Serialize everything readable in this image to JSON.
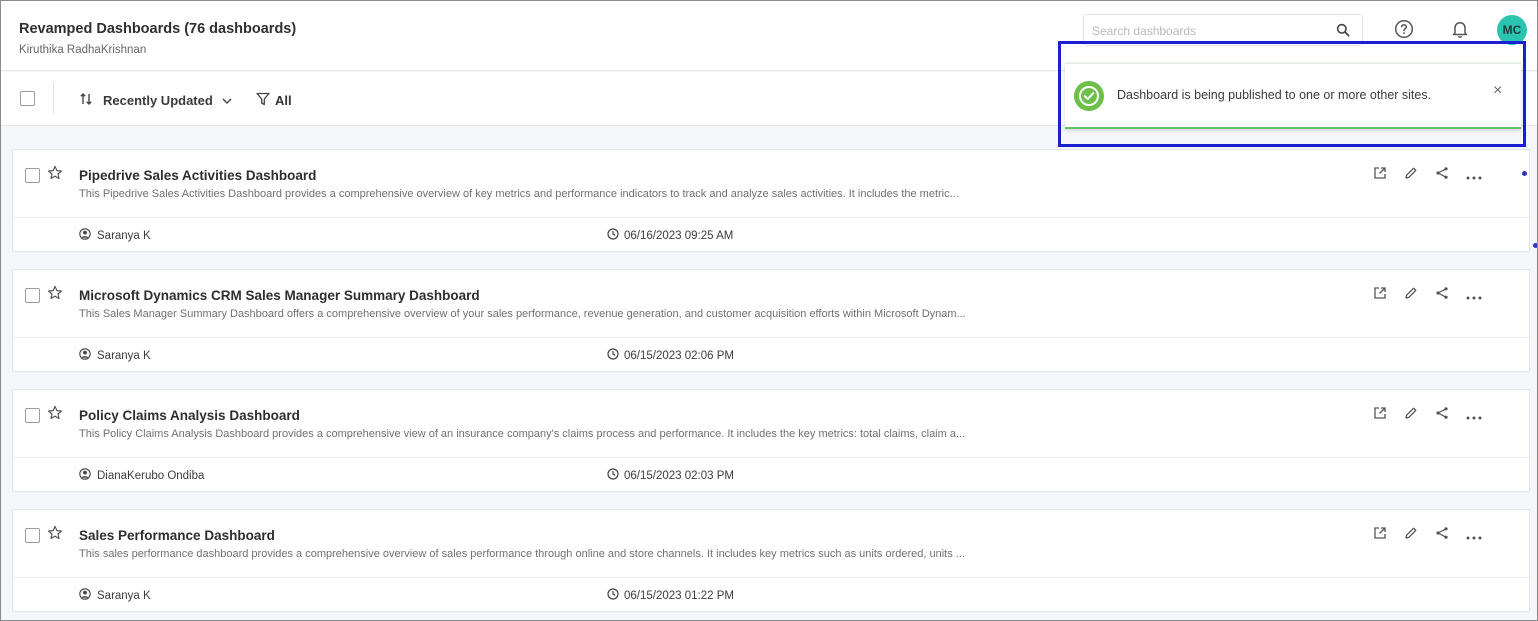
{
  "header": {
    "title": "Revamped Dashboards (76 dashboards)",
    "subtitle": "Kiruthika RadhaKrishnan",
    "search_placeholder": "Search dashboards",
    "avatar_initials": "MC",
    "avatar_color": "#2bc4b1"
  },
  "toolbar": {
    "sort_label": "Recently Updated",
    "filter_label": "All"
  },
  "toast": {
    "message": "Dashboard is being published to one or more other sites.",
    "close_glyph": "×",
    "status_color": "#6cc04a",
    "highlight_color": "#1a1fd1"
  },
  "dashboards": [
    {
      "name": "Pipedrive Sales Activities Dashboard",
      "description": "This Pipedrive Sales Activities Dashboard provides a comprehensive overview of key metrics and performance indicators to track and analyze sales activities. It includes the metric...",
      "owner": "Saranya K",
      "updated": "06/16/2023 09:25 AM"
    },
    {
      "name": "Microsoft Dynamics CRM Sales Manager Summary Dashboard",
      "description": "This Sales Manager Summary Dashboard offers a comprehensive overview of your sales performance, revenue generation, and customer acquisition efforts within Microsoft Dynam...",
      "owner": "Saranya K",
      "updated": "06/15/2023 02:06 PM"
    },
    {
      "name": "Policy Claims Analysis Dashboard",
      "description": "This Policy Claims Analysis Dashboard provides a comprehensive view of an insurance company's claims process and performance. It includes the key metrics: total claims, claim a...",
      "owner": "DianaKerubo Ondiba",
      "updated": "06/15/2023 02:03 PM"
    },
    {
      "name": "Sales Performance Dashboard",
      "description": "This sales performance dashboard provides a comprehensive overview of sales performance through online and store channels. It includes key metrics such as units ordered, units ...",
      "owner": "Saranya K",
      "updated": "06/15/2023 01:22 PM"
    }
  ]
}
